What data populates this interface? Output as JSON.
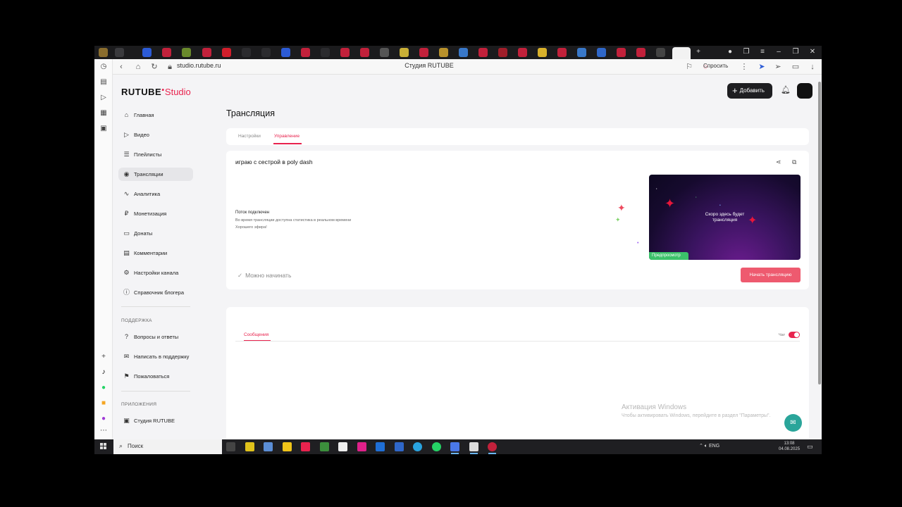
{
  "browser": {
    "url": "studio.rutube.ru",
    "page_title": "Студия RUTUBE",
    "ask_label": "Спросить"
  },
  "app": {
    "logo_main": "RUTUBE",
    "logo_sub": "Studio",
    "add_label": "Добавить"
  },
  "sidebar": {
    "items": [
      {
        "label": "Главная",
        "icon": "home-icon",
        "glyph": "⌂"
      },
      {
        "label": "Видео",
        "icon": "video-icon",
        "glyph": "▷"
      },
      {
        "label": "Плейлисты",
        "icon": "playlist-icon",
        "glyph": "☰"
      },
      {
        "label": "Трансляции",
        "icon": "broadcast-icon",
        "glyph": "◉"
      },
      {
        "label": "Аналитика",
        "icon": "analytics-icon",
        "glyph": "∿"
      },
      {
        "label": "Монетизация",
        "icon": "monetization-icon",
        "glyph": "₽"
      },
      {
        "label": "Донаты",
        "icon": "donations-icon",
        "glyph": "▭"
      },
      {
        "label": "Комментарии",
        "icon": "comments-icon",
        "glyph": "▤"
      },
      {
        "label": "Настройки канала",
        "icon": "settings-icon",
        "glyph": "⚙"
      },
      {
        "label": "Справочник блогера",
        "icon": "info-icon",
        "glyph": "ⓘ"
      }
    ],
    "support_title": "ПОДДЕРЖКА",
    "support": [
      {
        "label": "Вопросы и ответы",
        "icon": "question-icon",
        "glyph": "?"
      },
      {
        "label": "Написать в поддержку",
        "icon": "mail-icon",
        "glyph": "✉"
      },
      {
        "label": "Пожаловаться",
        "icon": "flag-icon",
        "glyph": "⚑"
      }
    ],
    "apps_title": "ПРИЛОЖЕНИЯ",
    "apps": [
      {
        "label": "Студия RUTUBE",
        "icon": "app-icon",
        "glyph": "▣"
      }
    ]
  },
  "page": {
    "title": "Трансляция",
    "tabs": [
      {
        "label": "Настройки"
      },
      {
        "label": "Управление"
      }
    ]
  },
  "stream": {
    "name": "играю с сестрой в poly dash",
    "status_title": "Поток подключен",
    "status_line1": "Во время трансляции доступна статистика в реальном времени",
    "status_line2": "Хорошего эфира!",
    "ready_label": "Можно начинать",
    "preview_line1": "Скоро здесь будет",
    "preview_line2": "трансляция",
    "preview_badge": "Предпросмотр",
    "start_label": "Начать трансляцию"
  },
  "chat": {
    "tab_label": "Сообщения",
    "toggle_label": "Чат",
    "toggle_on": true
  },
  "windows": {
    "activation_title": "Активация Windows",
    "activation_sub": "Чтобы активировать Windows, перейдите в раздел \"Параметры\".",
    "search_placeholder": "Поиск",
    "lang": "ENG",
    "time": "13:08",
    "date": "04.08.2025"
  },
  "colors": {
    "accent": "#e8234e",
    "start_button": "#ee5a6f",
    "preview_badge": "#3cc16a",
    "help_button": "#2aa59a"
  }
}
